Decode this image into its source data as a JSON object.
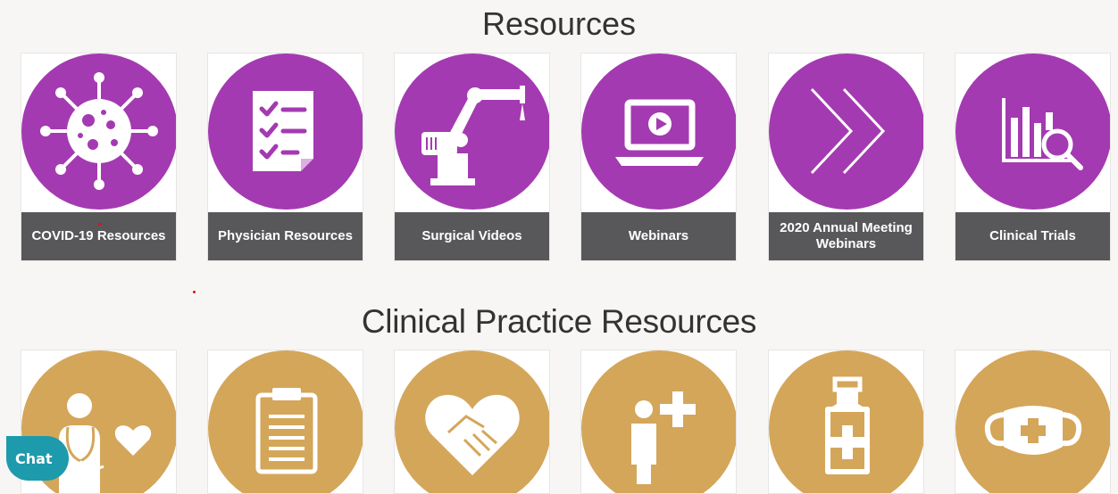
{
  "sections": {
    "resources": {
      "title": "Resources",
      "items": [
        {
          "label": "COVID-19  Resources",
          "icon": "virus-icon"
        },
        {
          "label": "Physician Resources",
          "icon": "checklist-icon"
        },
        {
          "label": "Surgical Videos",
          "icon": "robot-arm-icon"
        },
        {
          "label": "Webinars",
          "icon": "laptop-play-icon"
        },
        {
          "label": "2020 Annual Meeting Webinars",
          "icon": "double-chevron-icon"
        },
        {
          "label": "Clinical Trials",
          "icon": "chart-magnifier-icon"
        }
      ]
    },
    "clinical_practice": {
      "title": "Clinical Practice Resources",
      "items": [
        {
          "icon": "doctor-stethoscope-heart-icon"
        },
        {
          "icon": "clipboard-icon"
        },
        {
          "icon": "heart-handshake-icon"
        },
        {
          "icon": "person-plus-icon"
        },
        {
          "icon": "medicine-bottle-icon"
        },
        {
          "icon": "face-mask-icon"
        }
      ]
    }
  },
  "chat": {
    "label": "Chat"
  },
  "colors": {
    "purple": "#a43ab1",
    "gold": "#d4a65a",
    "label_bar": "#58585a",
    "chat": "#1e9aad"
  }
}
